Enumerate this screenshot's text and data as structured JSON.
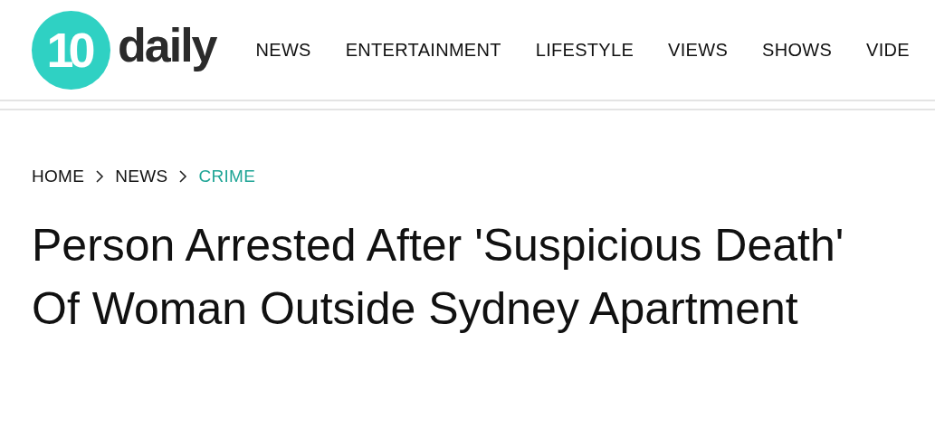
{
  "logo": {
    "badge": "10",
    "wordmark": "daily"
  },
  "nav": [
    {
      "label": "NEWS"
    },
    {
      "label": "ENTERTAINMENT"
    },
    {
      "label": "LIFESTYLE"
    },
    {
      "label": "VIEWS"
    },
    {
      "label": "SHOWS"
    },
    {
      "label": "VIDE"
    }
  ],
  "breadcrumb": [
    {
      "label": "HOME",
      "selected": false
    },
    {
      "label": "NEWS",
      "selected": false
    },
    {
      "label": "CRIME",
      "selected": true
    }
  ],
  "headline": "Person Arrested After 'Suspicious Death' Of Woman Outside Sydney Apartment"
}
